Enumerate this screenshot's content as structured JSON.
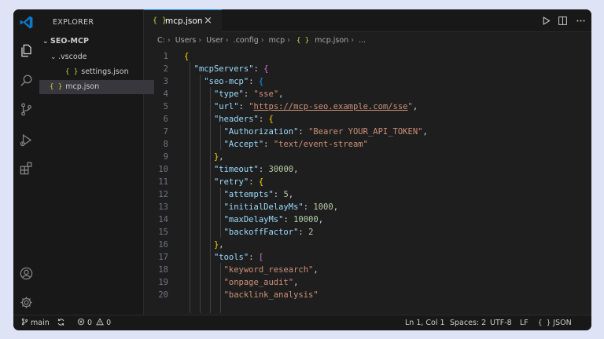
{
  "sidebar": {
    "title": "EXPLORER",
    "root": "SEO-MCP",
    "folder": ".vscode",
    "files": [
      "settings.json",
      "mcp.json"
    ]
  },
  "tab": {
    "label": "mcp.json",
    "close": "×"
  },
  "breadcrumb": [
    "C:",
    "Users",
    "User",
    ".config",
    "mcp",
    "mcp.json",
    "..."
  ],
  "icons": {
    "file_icon": "{ }"
  },
  "editor": {
    "lines": [
      [
        [
          "b1",
          "{"
        ]
      ],
      [
        [
          "p",
          "  "
        ],
        [
          "k",
          "\"mcpServers\""
        ],
        [
          "p",
          ": "
        ],
        [
          "b2",
          "{"
        ]
      ],
      [
        [
          "p",
          "    "
        ],
        [
          "k",
          "\"seo-mcp\""
        ],
        [
          "p",
          ": "
        ],
        [
          "b3",
          "{"
        ]
      ],
      [
        [
          "p",
          "      "
        ],
        [
          "k",
          "\"type\""
        ],
        [
          "p",
          ": "
        ],
        [
          "s",
          "\"sse\""
        ],
        [
          "p",
          ","
        ]
      ],
      [
        [
          "p",
          "      "
        ],
        [
          "k",
          "\"url\""
        ],
        [
          "p",
          ": "
        ],
        [
          "s",
          "\""
        ],
        [
          "su",
          "https://mcp-seo.example.com/sse"
        ],
        [
          "s",
          "\""
        ],
        [
          "p",
          ","
        ]
      ],
      [
        [
          "p",
          "      "
        ],
        [
          "k",
          "\"headers\""
        ],
        [
          "p",
          ": "
        ],
        [
          "b1",
          "{"
        ]
      ],
      [
        [
          "p",
          "        "
        ],
        [
          "k",
          "\"Authorization\""
        ],
        [
          "p",
          ": "
        ],
        [
          "s",
          "\"Bearer YOUR_API_TOKEN\""
        ],
        [
          "p",
          ","
        ]
      ],
      [
        [
          "p",
          "        "
        ],
        [
          "k",
          "\"Accept\""
        ],
        [
          "p",
          ": "
        ],
        [
          "s",
          "\"text/event-stream\""
        ]
      ],
      [
        [
          "p",
          "      "
        ],
        [
          "b1",
          "}"
        ],
        [
          "p",
          ","
        ]
      ],
      [
        [
          "p",
          "      "
        ],
        [
          "k",
          "\"timeout\""
        ],
        [
          "p",
          ": "
        ],
        [
          "n",
          "30000"
        ],
        [
          "p",
          ","
        ]
      ],
      [
        [
          "p",
          "      "
        ],
        [
          "k",
          "\"retry\""
        ],
        [
          "p",
          ": "
        ],
        [
          "b1",
          "{"
        ]
      ],
      [
        [
          "p",
          "        "
        ],
        [
          "k",
          "\"attempts\""
        ],
        [
          "p",
          ": "
        ],
        [
          "n",
          "5"
        ],
        [
          "p",
          ","
        ]
      ],
      [
        [
          "p",
          "        "
        ],
        [
          "k",
          "\"initialDelayMs\""
        ],
        [
          "p",
          ": "
        ],
        [
          "n",
          "1000"
        ],
        [
          "p",
          ","
        ]
      ],
      [
        [
          "p",
          "        "
        ],
        [
          "k",
          "\"maxDelayMs\""
        ],
        [
          "p",
          ": "
        ],
        [
          "n",
          "10000"
        ],
        [
          "p",
          ","
        ]
      ],
      [
        [
          "p",
          "        "
        ],
        [
          "k",
          "\"backoffFactor\""
        ],
        [
          "p",
          ": "
        ],
        [
          "n",
          "2"
        ]
      ],
      [
        [
          "p",
          "      "
        ],
        [
          "b1",
          "}"
        ],
        [
          "p",
          ","
        ]
      ],
      [
        [
          "p",
          "      "
        ],
        [
          "k",
          "\"tools\""
        ],
        [
          "p",
          ": "
        ],
        [
          "b2",
          "["
        ]
      ],
      [
        [
          "p",
          "        "
        ],
        [
          "s",
          "\"keyword_research\""
        ],
        [
          "p",
          ","
        ]
      ],
      [
        [
          "p",
          "        "
        ],
        [
          "s",
          "\"onpage_audit\""
        ],
        [
          "p",
          ","
        ]
      ],
      [
        [
          "p",
          "        "
        ],
        [
          "s",
          "\"backlink_analysis\""
        ]
      ]
    ]
  },
  "status": {
    "branch": "main",
    "errors": "0",
    "warnings": "0",
    "position": "Ln 1, Col 1",
    "spaces": "Spaces: 2",
    "encoding": "UTF-8",
    "eol": "LF",
    "language": "JSON"
  },
  "colors": {
    "accent": "#0078d4",
    "editor_bg": "#1e1e1e",
    "sidebar_bg": "#181818"
  }
}
